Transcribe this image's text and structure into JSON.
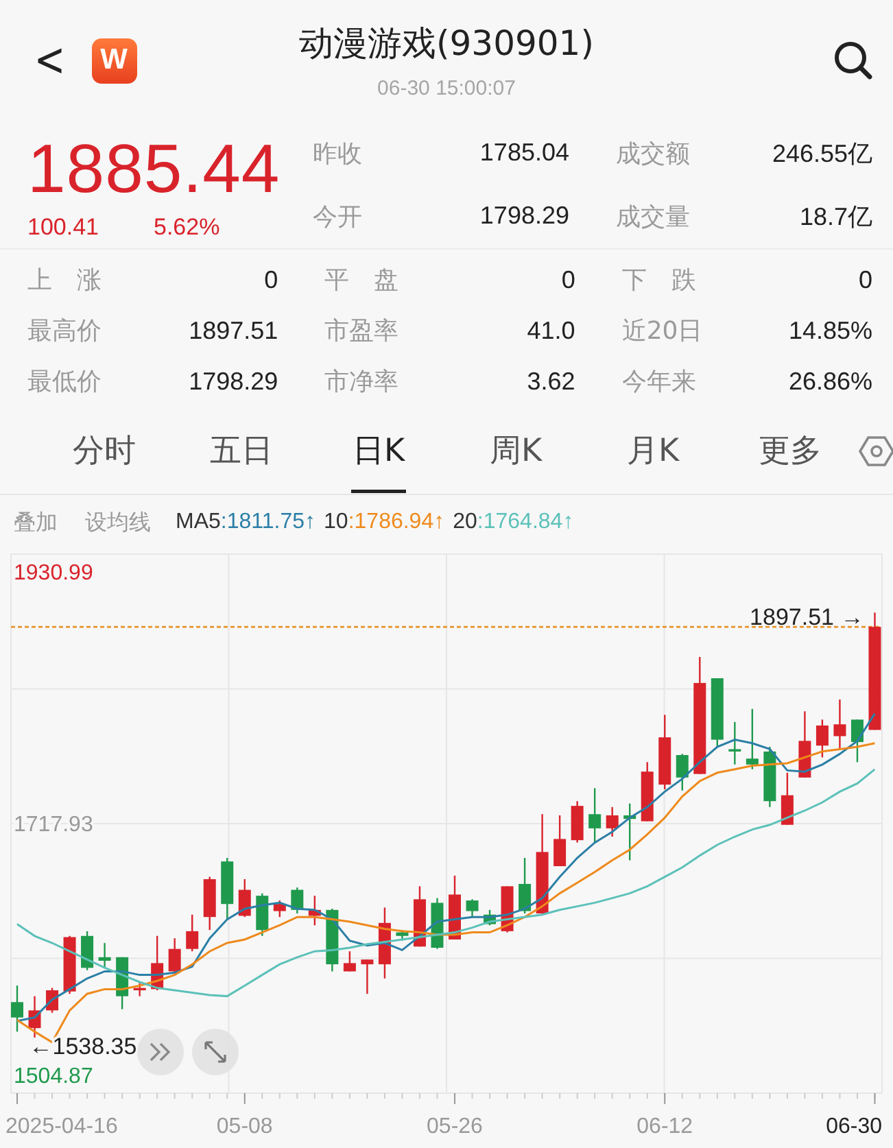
{
  "header": {
    "back": "<",
    "logo": "W",
    "title": "动漫游戏(930901)",
    "time": "06-30 15:00:07"
  },
  "quote": {
    "price": "1885.44",
    "change": "100.41",
    "change_pct": "5.62%"
  },
  "stats": [
    [
      {
        "label": "昨收",
        "value": "1785.04"
      },
      {
        "label": "成交额",
        "value": "246.55亿"
      }
    ],
    [
      {
        "label": "今开",
        "value": "1798.29"
      },
      {
        "label": "成交量",
        "value": "18.7亿"
      }
    ]
  ],
  "breadth": [
    [
      {
        "label": "上　涨",
        "value": "0"
      },
      {
        "label": "平　盘",
        "value": "0"
      },
      {
        "label": "下　跌",
        "value": "0"
      }
    ],
    [
      {
        "label": "最高价",
        "value": "1897.51"
      },
      {
        "label": "市盈率",
        "value": "41.0"
      },
      {
        "label": "近20日",
        "value": "14.85%"
      }
    ],
    [
      {
        "label": "最低价",
        "value": "1798.29"
      },
      {
        "label": "市净率",
        "value": "3.62"
      },
      {
        "label": "今年来",
        "value": "26.86%"
      }
    ]
  ],
  "tabs": [
    {
      "label": "分时",
      "selected": false
    },
    {
      "label": "五日",
      "selected": false
    },
    {
      "label": "日K",
      "selected": true
    },
    {
      "label": "周K",
      "selected": false
    },
    {
      "label": "月K",
      "selected": false
    },
    {
      "label": "更多",
      "selected": false
    }
  ],
  "tools": [
    "叠加",
    "设均线"
  ],
  "ma_legend": [
    {
      "sep": ":",
      "value": "1811.75",
      "arrow": "↑"
    },
    {
      "sep": ":",
      "value": "1786.94",
      "arrow": "↑"
    },
    {
      "sep": ":",
      "value": "1764.84",
      "arrow": "↑"
    }
  ],
  "chart_data": {
    "type": "candlestick",
    "ylim": [
      1491,
      1947
    ],
    "categories": [
      null,
      null,
      null,
      null,
      null,
      null,
      null,
      null,
      null,
      null,
      null,
      null,
      null,
      "05-08",
      null,
      null,
      null,
      null,
      null,
      null,
      null,
      null,
      null,
      null,
      null,
      "05-26",
      null,
      null,
      null,
      null,
      null,
      null,
      null,
      null,
      null,
      null,
      null,
      "06-12",
      null,
      null,
      null,
      null,
      null,
      null,
      null,
      null,
      null,
      null,
      null,
      null
    ],
    "grid": true,
    "ohlc": [
      [
        1568,
        1582,
        1543,
        1555
      ],
      [
        1546,
        1573,
        1538,
        1561
      ],
      [
        1561,
        1580,
        1559,
        1578
      ],
      [
        1577,
        1624,
        1575,
        1623
      ],
      [
        1624,
        1628,
        1595,
        1597
      ],
      [
        1606,
        1618,
        1597,
        1603
      ],
      [
        1606,
        1606,
        1562,
        1573
      ],
      [
        1578,
        1584,
        1573,
        1580
      ],
      [
        1579,
        1624,
        1578,
        1601
      ],
      [
        1594,
        1622,
        1591,
        1613
      ],
      [
        1613,
        1642,
        1611,
        1628
      ],
      [
        1640,
        1674,
        1629,
        1672
      ],
      [
        1687,
        1690,
        1638,
        1651
      ],
      [
        1641,
        1672,
        1640,
        1663
      ],
      [
        1658,
        1660,
        1624,
        1629
      ],
      [
        1645,
        1654,
        1640,
        1651
      ],
      [
        1663,
        1665,
        1643,
        1646
      ],
      [
        1641,
        1658,
        1633,
        1646
      ],
      [
        1646,
        1647,
        1594,
        1600
      ],
      [
        1594,
        1611,
        1594,
        1601
      ],
      [
        1600,
        1604,
        1575,
        1604
      ],
      [
        1600,
        1648,
        1588,
        1635
      ],
      [
        1627,
        1629,
        1620,
        1624
      ],
      [
        1615,
        1666,
        1615,
        1655
      ],
      [
        1652,
        1656,
        1613,
        1614
      ],
      [
        1621,
        1675,
        1621,
        1659
      ],
      [
        1654,
        1655,
        1640,
        1645
      ],
      [
        1642,
        1646,
        1633,
        1634
      ],
      [
        1628,
        1666,
        1627,
        1666
      ],
      [
        1668,
        1690,
        1643,
        1645
      ],
      [
        1643,
        1727,
        1643,
        1695
      ],
      [
        1683,
        1726,
        1683,
        1706
      ],
      [
        1705,
        1738,
        1703,
        1734
      ],
      [
        1727,
        1749,
        1703,
        1715
      ],
      [
        1715,
        1733,
        1708,
        1726
      ],
      [
        1726,
        1736,
        1688,
        1723
      ],
      [
        1721,
        1771,
        1721,
        1763
      ],
      [
        1752,
        1811,
        1748,
        1792
      ],
      [
        1777,
        1778,
        1747,
        1758
      ],
      [
        1761,
        1860,
        1761,
        1838
      ],
      [
        1842,
        1842,
        1784,
        1790
      ],
      [
        1782,
        1805,
        1769,
        1780
      ],
      [
        1774,
        1816,
        1765,
        1769
      ],
      [
        1780,
        1784,
        1733,
        1738
      ],
      [
        1718,
        1762,
        1718,
        1743
      ],
      [
        1758,
        1814,
        1758,
        1789
      ],
      [
        1785,
        1807,
        1775,
        1802
      ],
      [
        1793,
        1824,
        1782,
        1803
      ],
      [
        1807,
        1807,
        1771,
        1788
      ],
      [
        1798.29,
        1897.51,
        1798.29,
        1885.44
      ]
    ],
    "yticks": [
      {
        "value": 1930.99,
        "label": "1930.99"
      },
      {
        "value": 1717.93,
        "label": "1717.93"
      },
      {
        "value": 1504.87,
        "label": "1504.87"
      }
    ],
    "series": [
      {
        "name": "MA5",
        "type": "line",
        "color": "#2b7fa6",
        "values": [
          1552,
          1555,
          1570,
          1579,
          1588,
          1594,
          1594,
          1591,
          1591,
          1593,
          1598,
          1622,
          1638,
          1647,
          1650,
          1652,
          1647,
          1646,
          1638,
          1620,
          1616,
          1618,
          1612,
          1624,
          1636,
          1638,
          1640,
          1640,
          1642,
          1647,
          1656,
          1674,
          1690,
          1703,
          1712,
          1724,
          1733,
          1746,
          1757,
          1771,
          1784,
          1790,
          1787,
          1782,
          1764,
          1763,
          1769,
          1778,
          1789,
          1812
        ]
      },
      {
        "name": "10",
        "type": "line",
        "color": "#ee8a1c",
        "values": [
          1553,
          1543,
          1534,
          1561,
          1575,
          1579,
          1579,
          1582,
          1586,
          1591,
          1600,
          1611,
          1618,
          1621,
          1627,
          1633,
          1640,
          1640,
          1638,
          1636,
          1633,
          1630,
          1628,
          1627,
          1625,
          1625,
          1627,
          1627,
          1633,
          1640,
          1649,
          1660,
          1669,
          1678,
          1688,
          1697,
          1710,
          1724,
          1742,
          1755,
          1762,
          1765,
          1768,
          1769,
          1770,
          1775,
          1780,
          1782,
          1784,
          1787
        ]
      },
      {
        "name": "20",
        "type": "line",
        "color": "#5cc1b9",
        "values": [
          1634,
          1624,
          1618,
          1611,
          1604,
          1597,
          1591,
          1585,
          1580,
          1578,
          1576,
          1574,
          1573,
          1582,
          1591,
          1600,
          1606,
          1611,
          1612,
          1614,
          1617,
          1619,
          1621,
          1623,
          1625,
          1627,
          1631,
          1636,
          1638,
          1640,
          1642,
          1646,
          1649,
          1652,
          1656,
          1660,
          1666,
          1674,
          1682,
          1692,
          1701,
          1708,
          1714,
          1718,
          1724,
          1730,
          1737,
          1746,
          1753,
          1765
        ]
      }
    ],
    "annotations": [
      {
        "text": "1897.51 →"
      },
      {
        "text": "←1538.35"
      }
    ],
    "ref_lines": [
      {
        "axis": "y",
        "value": 1885.44
      }
    ]
  },
  "chart_dates": {
    "start": "2025-04-16",
    "end": "06-30"
  }
}
